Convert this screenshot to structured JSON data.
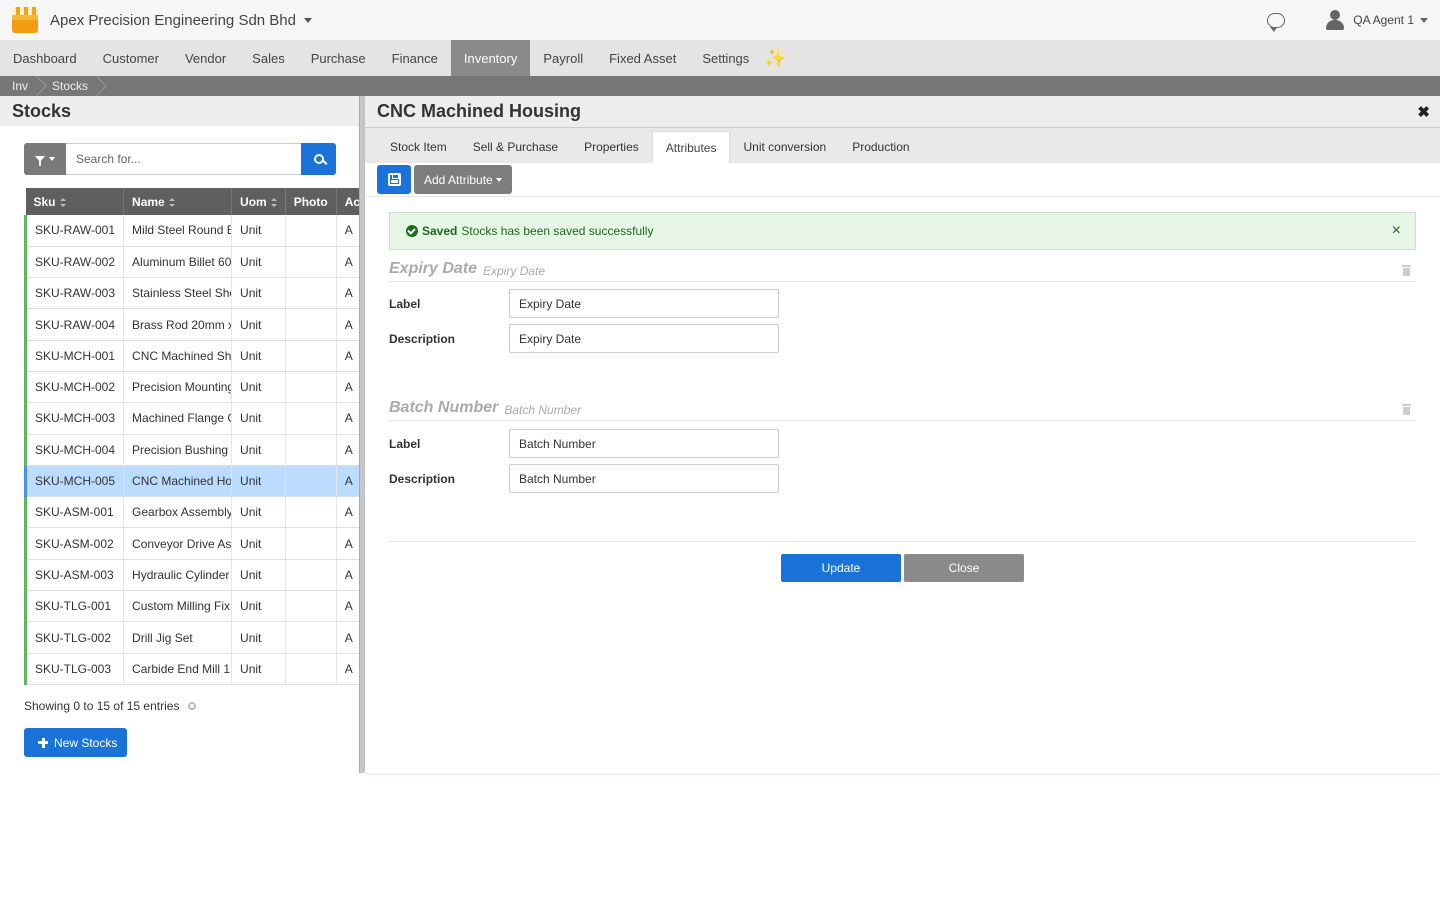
{
  "header": {
    "company": "Apex Precision Engineering Sdn Bhd",
    "user": "QA Agent 1"
  },
  "nav": {
    "items": [
      "Dashboard",
      "Customer",
      "Vendor",
      "Sales",
      "Purchase",
      "Finance",
      "Inventory",
      "Payroll",
      "Fixed Asset",
      "Settings"
    ],
    "active": "Inventory",
    "sparkle": "✨"
  },
  "breadcrumb": [
    "Inv",
    "Stocks"
  ],
  "left": {
    "title": "Stocks",
    "search_placeholder": "Search for...",
    "columns": [
      "Sku",
      "Name",
      "Uom",
      "Photo",
      "Ac"
    ],
    "rows": [
      {
        "sku": "SKU-RAW-001",
        "name": "Mild Steel Round B",
        "uom": "Unit",
        "a": "A"
      },
      {
        "sku": "SKU-RAW-002",
        "name": "Aluminum Billet 60",
        "uom": "Unit",
        "a": "A"
      },
      {
        "sku": "SKU-RAW-003",
        "name": "Stainless Steel She",
        "uom": "Unit",
        "a": "A"
      },
      {
        "sku": "SKU-RAW-004",
        "name": "Brass Rod 20mm x",
        "uom": "Unit",
        "a": "A"
      },
      {
        "sku": "SKU-MCH-001",
        "name": "CNC Machined Sh",
        "uom": "Unit",
        "a": "A"
      },
      {
        "sku": "SKU-MCH-002",
        "name": "Precision Mounting",
        "uom": "Unit",
        "a": "A"
      },
      {
        "sku": "SKU-MCH-003",
        "name": "Machined Flange C",
        "uom": "Unit",
        "a": "A"
      },
      {
        "sku": "SKU-MCH-004",
        "name": "Precision Bushing",
        "uom": "Unit",
        "a": "A"
      },
      {
        "sku": "SKU-MCH-005",
        "name": "CNC Machined Ho",
        "uom": "Unit",
        "a": "A"
      },
      {
        "sku": "SKU-ASM-001",
        "name": "Gearbox Assembly",
        "uom": "Unit",
        "a": "A"
      },
      {
        "sku": "SKU-ASM-002",
        "name": "Conveyor Drive As",
        "uom": "Unit",
        "a": "A"
      },
      {
        "sku": "SKU-ASM-003",
        "name": "Hydraulic Cylinder",
        "uom": "Unit",
        "a": "A"
      },
      {
        "sku": "SKU-TLG-001",
        "name": "Custom Milling Fix",
        "uom": "Unit",
        "a": "A"
      },
      {
        "sku": "SKU-TLG-002",
        "name": "Drill Jig Set",
        "uom": "Unit",
        "a": "A"
      },
      {
        "sku": "SKU-TLG-003",
        "name": "Carbide End Mill 1",
        "uom": "Unit",
        "a": "A"
      }
    ],
    "selected_sku": "SKU-MCH-005",
    "showing": "Showing 0 to 15 of 15 entries",
    "new_button": "New Stocks"
  },
  "detail": {
    "title": "CNC Machined Housing",
    "close_glyph": "✖",
    "tabs": [
      "Stock Item",
      "Sell & Purchase",
      "Properties",
      "Attributes",
      "Unit conversion",
      "Production"
    ],
    "active_tab": "Attributes",
    "add_attribute": "Add Attribute",
    "alert": {
      "bold": "Saved",
      "text": "Stocks has been saved successfully",
      "close": "×"
    },
    "attributes": [
      {
        "name": "Expiry Date",
        "sub": "Expiry Date",
        "label_label": "Label",
        "label_value": "Expiry Date",
        "desc_label": "Description",
        "desc_value": "Expiry Date"
      },
      {
        "name": "Batch Number",
        "sub": "Batch Number",
        "label_label": "Label",
        "label_value": "Batch Number",
        "desc_label": "Description",
        "desc_value": "Batch Number"
      }
    ],
    "update_button": "Update",
    "close_button": "Close"
  },
  "colors": {
    "primary": "#1a73d9",
    "nav_active": "#8a8a8a",
    "success_bg": "#e6f5e6",
    "selected_row": "#bcdcff"
  }
}
